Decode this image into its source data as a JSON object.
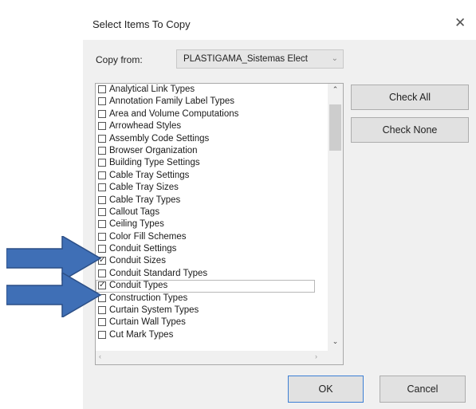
{
  "dialog": {
    "title": "Select Items To Copy",
    "close_glyph": "✕",
    "copy_from_label": "Copy from:",
    "copy_from_value": "PLASTIGAMA_Sistemas Elect",
    "dropdown_icon": "chevron-down-icon",
    "check_all_label": "Check All",
    "check_none_label": "Check None",
    "ok_label": "OK",
    "cancel_label": "Cancel"
  },
  "items": [
    {
      "label": "Analytical Link Types",
      "checked": false
    },
    {
      "label": "Annotation Family Label Types",
      "checked": false
    },
    {
      "label": "Area and Volume Computations",
      "checked": false
    },
    {
      "label": "Arrowhead Styles",
      "checked": false
    },
    {
      "label": "Assembly Code Settings",
      "checked": false
    },
    {
      "label": "Browser Organization",
      "checked": false
    },
    {
      "label": "Building Type Settings",
      "checked": false
    },
    {
      "label": "Cable Tray Settings",
      "checked": false
    },
    {
      "label": "Cable Tray Sizes",
      "checked": false
    },
    {
      "label": "Cable Tray Types",
      "checked": false
    },
    {
      "label": "Callout Tags",
      "checked": false
    },
    {
      "label": "Ceiling Types",
      "checked": false
    },
    {
      "label": "Color Fill Schemes",
      "checked": false
    },
    {
      "label": "Conduit Settings",
      "checked": false
    },
    {
      "label": "Conduit Sizes",
      "checked": true
    },
    {
      "label": "Conduit Standard Types",
      "checked": false
    },
    {
      "label": "Conduit Types",
      "checked": true,
      "focused": true
    },
    {
      "label": "Construction Types",
      "checked": false
    },
    {
      "label": "Curtain System Types",
      "checked": false
    },
    {
      "label": "Curtain Wall Types",
      "checked": false
    },
    {
      "label": "Cut Mark Types",
      "checked": false
    }
  ],
  "colors": {
    "arrow_fill": "#3f6fb6",
    "arrow_stroke": "#2c4f86",
    "dialog_bg": "#f0f0f0",
    "ok_border": "#3c7fd4"
  }
}
